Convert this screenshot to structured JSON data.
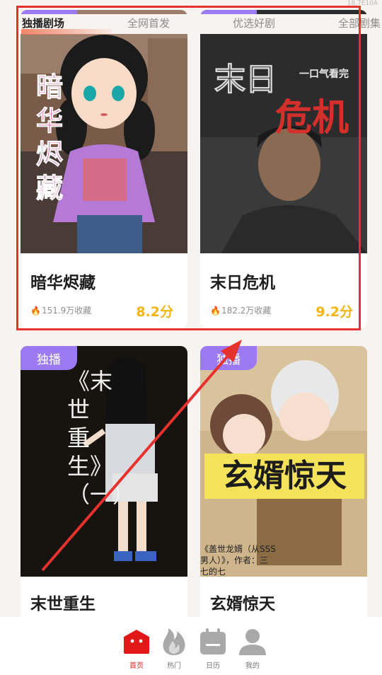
{
  "status": {
    "corner_text": "18.7E10A"
  },
  "tabs": [
    {
      "label": "独播剧场",
      "active": true
    },
    {
      "label": "全网首发",
      "active": false
    },
    {
      "label": "优选好剧",
      "active": false
    },
    {
      "label": "全部剧集",
      "active": false
    }
  ],
  "cards": [
    {
      "badge": "独播",
      "title": "暗华烬藏",
      "favorites": "151.9万收藏",
      "score": "8.2分",
      "cover_text": [
        "暗",
        "华",
        "烬",
        "藏"
      ]
    },
    {
      "badge": "独播",
      "title": "末日危机",
      "favorites": "182.2万收藏",
      "score": "9.2分",
      "cover_text_1": "末日",
      "cover_text_2": "一口气看完",
      "cover_text_3": "危机"
    },
    {
      "badge": "独播",
      "title": "末世重生",
      "cover_text": "《末世重生》（一）"
    },
    {
      "badge": "独播",
      "title": "玄婿惊天",
      "cover_text": "玄婿惊天",
      "cover_caption_1": "《盖世龙婿（从SSS",
      "cover_caption_2": "男人）》，作者：三",
      "cover_caption_3": "七的七"
    }
  ],
  "nav": [
    {
      "label": "首页",
      "icon": "home-icon",
      "active": true
    },
    {
      "label": "热门",
      "icon": "flame-icon",
      "active": false
    },
    {
      "label": "日历",
      "icon": "calendar-icon",
      "active": false
    },
    {
      "label": "我的",
      "icon": "profile-icon",
      "active": false
    }
  ],
  "colors": {
    "accent_red": "#e02020",
    "badge_purple": "#9b7af3",
    "score_yellow": "#f3b512",
    "annotation_red": "#e6322f"
  }
}
